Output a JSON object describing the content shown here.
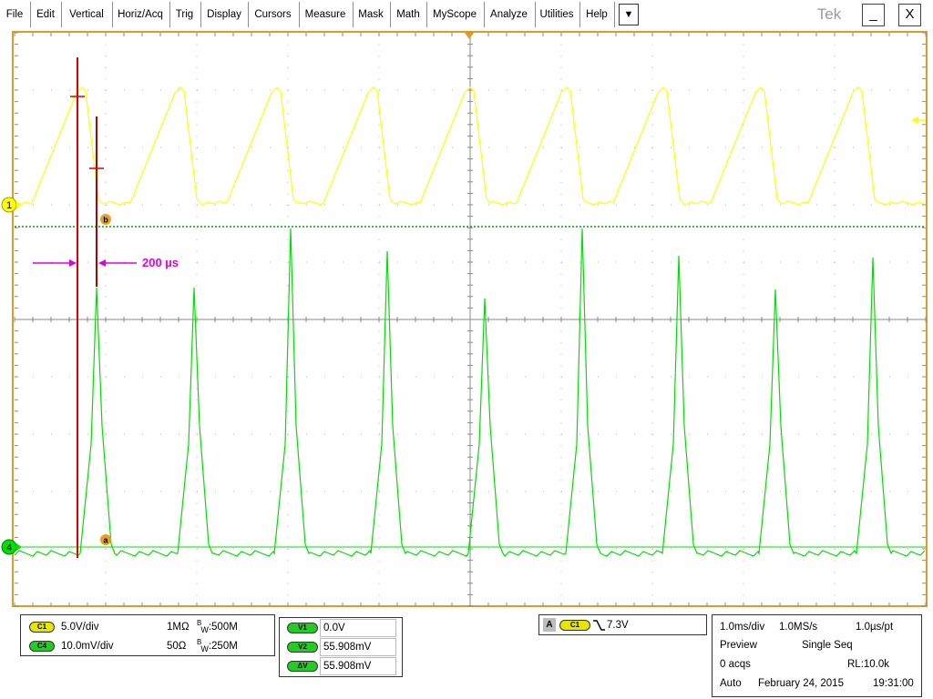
{
  "menu": {
    "items": [
      "File",
      "Edit",
      "Vertical",
      "Horiz/Acq",
      "Trig",
      "Display",
      "Cursors",
      "Measure",
      "Mask",
      "Math",
      "MyScope",
      "Analyze",
      "Utilities",
      "Help"
    ],
    "more_label": "▼",
    "brand": "Tek",
    "minimize_label": "_",
    "close_label": "X"
  },
  "graticule": {
    "channel_markers": {
      "ch1": "1",
      "ch4": "4"
    },
    "cursor_markers": {
      "a": "a",
      "b": "b"
    },
    "delta_annotation": "200 µs",
    "colors": {
      "ch1": "#ffff00",
      "ch4": "#00e000",
      "cursor": "#e00000",
      "annotation": "#e000e0",
      "frame": "#e09a2a"
    }
  },
  "channels": {
    "c1": {
      "badge": "C1",
      "scale": "5.0V/div",
      "impedance": "1MΩ",
      "bw_prefix": "B",
      "bw_sub": "W",
      "bandwidth": ":500M"
    },
    "c4": {
      "badge": "C4",
      "scale": "10.0mV/div",
      "impedance": "50Ω",
      "bw_prefix": "B",
      "bw_sub": "W",
      "bandwidth": ":250M"
    }
  },
  "cursors": {
    "v1_label": "V1",
    "v1_value": "0.0V",
    "v2_label": "V2",
    "v2_value": "55.908mV",
    "dv_label": "ΔV",
    "dv_value": "55.908mV"
  },
  "trigger": {
    "mode_label": "A",
    "source_badge": "C1",
    "slope_icon": "falling-edge",
    "level": "7.3V"
  },
  "acquisition": {
    "time_div": "1.0ms/div",
    "sample_rate": "1.0MS/s",
    "resolution": "1.0µs/pt",
    "state": "Preview",
    "run_mode": "Single Seq",
    "acqs": "0 acqs",
    "record_length": "RL:10.0k",
    "trigger_mode": "Auto",
    "date": "February 24, 2015",
    "time": "19:31:00"
  }
}
